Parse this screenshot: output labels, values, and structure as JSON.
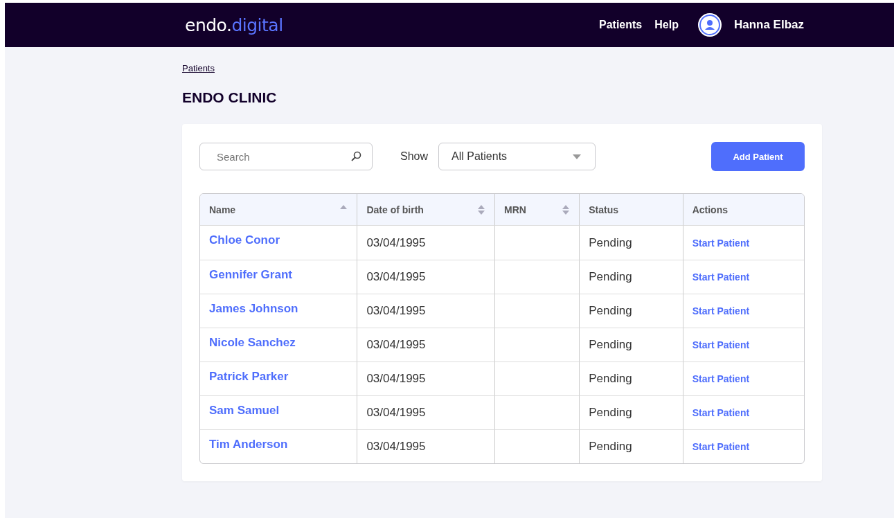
{
  "navbar": {
    "logo": {
      "part_1": "endo.",
      "part_2": "digital"
    },
    "links": [
      "Patients",
      "Help"
    ],
    "user": {
      "name": "Hanna Elbaz"
    }
  },
  "breadcrumb": "Patients",
  "title": "ENDO CLINIC",
  "toolbar": {
    "search": {
      "placeholder": "Search"
    },
    "filter": {
      "label": "Show",
      "value": "All Patients"
    },
    "add_button": "Add Patient"
  },
  "table": {
    "columns": [
      {
        "label": "Name",
        "sorted": true
      },
      {
        "label": "Date of birth",
        "sorted": false
      },
      {
        "label": "MRN",
        "sorted": false
      },
      {
        "label": "Status"
      },
      {
        "label": "Actions"
      }
    ],
    "rows": [
      {
        "name": "Chloe Conor",
        "dob": "03/04/1995",
        "status": "Pending",
        "action": "Start Patient"
      },
      {
        "name": "Gennifer Grant",
        "dob": "03/04/1995",
        "status": "Pending",
        "action": "Start Patient"
      },
      {
        "name": "James Johnson",
        "dob": "03/04/1995",
        "status": "Pending",
        "action": "Start Patient"
      },
      {
        "name": "Nicole Sanchez",
        "dob": "03/04/1995",
        "status": "Pending",
        "action": "Start Patient"
      },
      {
        "name": "Patrick Parker",
        "dob": "03/04/1995",
        "status": "Pending",
        "action": "Start Patient"
      },
      {
        "name": "Sam Samuel",
        "dob": "03/04/1995",
        "status": "Pending",
        "action": "Start Patient"
      },
      {
        "name": "Tim Anderson",
        "dob": "03/04/1995",
        "status": "Pending",
        "action": "Start Patient"
      }
    ]
  }
}
